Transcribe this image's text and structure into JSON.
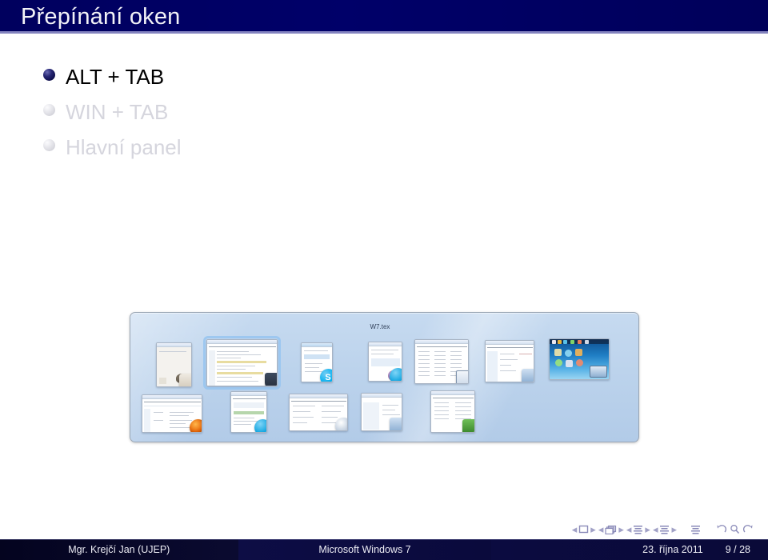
{
  "slide": {
    "title": "Přepínání oken",
    "header_color": "#000066",
    "body_background": "#ffffff"
  },
  "itemize": [
    {
      "label": "ALT + TAB",
      "state": "active"
    },
    {
      "label": "WIN + TAB",
      "state": "dimmed"
    },
    {
      "label": "Hlavní panel",
      "state": "dimmed"
    }
  ],
  "figure": {
    "name": "alt-tab-window-switcher",
    "caption": "W7.tex",
    "thumbnails": [
      {
        "app": "gimp-image-window",
        "icon": "gimp-icon",
        "selected": false
      },
      {
        "app": "w7-tex-editor",
        "icon": "shield-icon",
        "selected": true
      },
      {
        "app": "skype-window",
        "icon": "skype-icon",
        "selected": false
      },
      {
        "app": "mail-client-window",
        "icon": "mail-icon",
        "selected": false
      },
      {
        "app": "spreadsheet-window",
        "icon": "disk-icon",
        "selected": false
      },
      {
        "app": "explorer-window",
        "icon": "pc-icon",
        "selected": false
      },
      {
        "app": "windows-7-desktop",
        "icon": "desktop-icon",
        "selected": false
      },
      {
        "app": "firefox-browser-window",
        "icon": "firefox-icon",
        "selected": false
      },
      {
        "app": "mail-message-window",
        "icon": "mail-icon",
        "selected": false
      },
      {
        "app": "control-panel-window",
        "icon": "calc-icon",
        "selected": false
      },
      {
        "app": "media-window",
        "icon": "clock-icon",
        "selected": false
      },
      {
        "app": "database-window",
        "icon": "green-icon",
        "selected": false
      }
    ]
  },
  "navigation_symbols": [
    "slide-back",
    "slide-icon",
    "slide-forward",
    "frame-back",
    "frame-icon",
    "frame-forward",
    "subsection-back",
    "subsection-icon",
    "subsection-forward",
    "section-back",
    "section-icon",
    "section-forward",
    "appendix-icon",
    "back-icon",
    "search-icon",
    "forward-icon"
  ],
  "footer": {
    "author": "Mgr. Krejčí Jan  (UJEP)",
    "subject": "Microsoft Windows 7",
    "date": "23. října 2011",
    "page": "9 / 28"
  }
}
